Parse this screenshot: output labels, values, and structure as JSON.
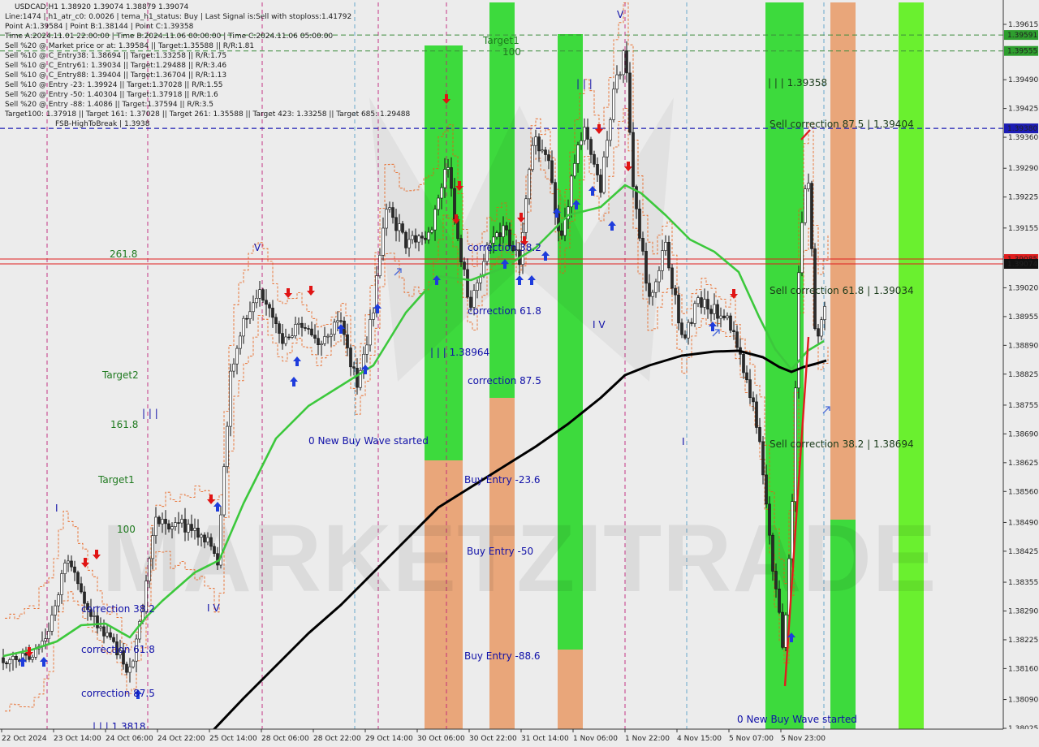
{
  "info_lines": [
    "USDCAD,H1  1.38920 1.39074 1.38879 1.39074",
    "Line:1474 | h1_atr_c0: 0.0026 | tema_h1_status: Buy | Last Signal is:Sell with stoploss:1.41792",
    "Point A:1.39584 | Point B:1.38144 | Point C:1.39358",
    "Time A:2024.11.01 22:00:00 | Time B:2024.11.06 00:00:00 | Time C:2024.11.06 05:00:00",
    "Sell %20 @ Market price or at: 1.39584 || Target:1.35588 || R/R:1.81",
    "Sell %10 @ C_Entry38: 1.38694 || Target:1.33258 || R/R:1.75",
    "Sell %10 @ C_Entry61: 1.39034 || Target:1.29488 || R/R:3.46",
    "Sell %10 @ C_Entry88: 1.39404 || Target:1.36704 || R/R:1.13",
    "Sell %10 @ Entry -23: 1.39924 || Target:1.37028 || R/R:1.55",
    "Sell %20 @ Entry -50: 1.40304 || Target:1.37918 || R/R:1.6",
    "Sell %20 @ Entry -88: 1.4086 || Target:1.37594 || R/R:3.5",
    "Target100: 1.37918 || Target 161: 1.37028 || Target 261: 1.35588 || Target 423: 1.33258 || Target 685: 1.29488",
    "FSB-HighToBreak | 1.3938"
  ],
  "colors": {
    "background": "#ececec",
    "bull_candle": "#ffffff",
    "bear_candle": "#2a2a2a",
    "ma_fast": "#3cc83c",
    "ma_slow": "#000000",
    "zone_green": "#2ed82e",
    "zone_orange": "#e8a070",
    "zone_bright": "#5ef01e",
    "dashed_blue": "#1c1cb4",
    "red_line": "#e01e1e",
    "arrow_up": "#1e3cdc",
    "arrow_down": "#e01414",
    "label_green": "#1f7a1f",
    "label_blue": "#1010a8"
  },
  "watermark": "MARKETZITRADE",
  "annotations": [
    {
      "text": "Target1",
      "kind": "green"
    },
    {
      "text": "100",
      "kind": "green"
    },
    {
      "text": "261.8",
      "kind": "green"
    },
    {
      "text": "Target2",
      "kind": "green"
    },
    {
      "text": "161.8",
      "kind": "green"
    },
    {
      "text": "Target1",
      "kind": "green"
    },
    {
      "text": "100",
      "kind": "green"
    },
    {
      "text": "| | | 1.39358",
      "kind": "dark"
    },
    {
      "text": "Sell correction 87.5 | 1.39404",
      "kind": "dark"
    },
    {
      "text": "Sell correction 61.8 | 1.39034",
      "kind": "dark"
    },
    {
      "text": "Sell correction 38.2 | 1.38694",
      "kind": "dark"
    },
    {
      "text": "| | | 1.38964",
      "kind": "blue"
    },
    {
      "text": "correction 38.2",
      "kind": "blue"
    },
    {
      "text": "correction 61.8",
      "kind": "blue"
    },
    {
      "text": "correction 87.5",
      "kind": "blue"
    },
    {
      "text": "0 New Buy Wave started",
      "kind": "blue"
    },
    {
      "text": "Buy Entry -23.6",
      "kind": "blue"
    },
    {
      "text": "Buy Entry -50",
      "kind": "blue"
    },
    {
      "text": "Buy Entry -88.6",
      "kind": "blue"
    },
    {
      "text": "correction 38.2",
      "kind": "blue"
    },
    {
      "text": "correction 61.8",
      "kind": "blue"
    },
    {
      "text": "correction 87.5",
      "kind": "blue"
    },
    {
      "text": "| | | 1.3818",
      "kind": "blue"
    },
    {
      "text": "0 New Buy Wave started",
      "kind": "blue"
    },
    {
      "text": "V",
      "kind": "blue"
    },
    {
      "text": "V",
      "kind": "blue"
    },
    {
      "text": "I V",
      "kind": "blue"
    },
    {
      "text": "I V",
      "kind": "blue"
    },
    {
      "text": "| | |",
      "kind": "blue"
    },
    {
      "text": "| | |",
      "kind": "blue"
    },
    {
      "text": "I",
      "kind": "blue"
    },
    {
      "text": "I",
      "kind": "blue"
    }
  ],
  "chart_data": {
    "type": "candlestick",
    "symbol": "USDCAD",
    "timeframe": "H1",
    "ohlc_header": [
      1.3892,
      1.39074,
      1.38879,
      1.39074
    ],
    "ylim": [
      1.38055,
      1.39665
    ],
    "y_ticks": [
      "1.39615",
      "1.39560",
      "1.39490",
      "1.39425",
      "1.39360",
      "1.39290",
      "1.39225",
      "1.39155",
      "1.39090",
      "1.39020",
      "1.38955",
      "1.38890",
      "1.38825",
      "1.38755",
      "1.38690",
      "1.38625",
      "1.38560",
      "1.38490",
      "1.38425",
      "1.38355",
      "1.38290",
      "1.38225",
      "1.38160",
      "1.38090",
      "1.38025"
    ],
    "y_ticks_plotted": [
      1.39615,
      1.3949,
      1.39425,
      1.3936,
      1.3929,
      1.39225,
      1.39155,
      1.3909,
      1.3902,
      1.38955,
      1.3889,
      1.38825,
      1.38755,
      1.3869,
      1.38625,
      1.3856,
      1.3849,
      1.38425,
      1.38355,
      1.3829,
      1.38225,
      1.3816,
      1.3809,
      1.38025
    ],
    "x_ticks": [
      "22 Oct 2024",
      "23 Oct 14:00",
      "24 Oct 06:00",
      "24 Oct 22:00",
      "25 Oct 14:00",
      "28 Oct 06:00",
      "28 Oct 22:00",
      "29 Oct 14:00",
      "30 Oct 06:00",
      "30 Oct 22:00",
      "31 Oct 14:00",
      "1 Nov 06:00",
      "1 Nov 22:00",
      "4 Nov 15:00",
      "5 Nov 07:00",
      "5 Nov 23:00"
    ],
    "price_labels": [
      {
        "text": "1.39591",
        "value": 1.39591
      },
      {
        "text": "1.39555",
        "value": 1.39555
      },
      {
        "text": "1.39380",
        "value": 1.3938
      },
      {
        "text": "1.39085",
        "value": 1.39085
      },
      {
        "text": "1.39074",
        "value": 1.39074
      }
    ],
    "level_lines": [
      {
        "value": 1.39591,
        "style": "dashed",
        "color": "green"
      },
      {
        "value": 1.39555,
        "style": "dashed",
        "color": "green"
      },
      {
        "value": 1.3938,
        "style": "dashed",
        "color": "blue"
      },
      {
        "value": 1.39085,
        "style": "solid",
        "color": "red"
      },
      {
        "value": 1.39074,
        "style": "solid",
        "color": "red"
      }
    ],
    "last_price": 1.39074
  }
}
